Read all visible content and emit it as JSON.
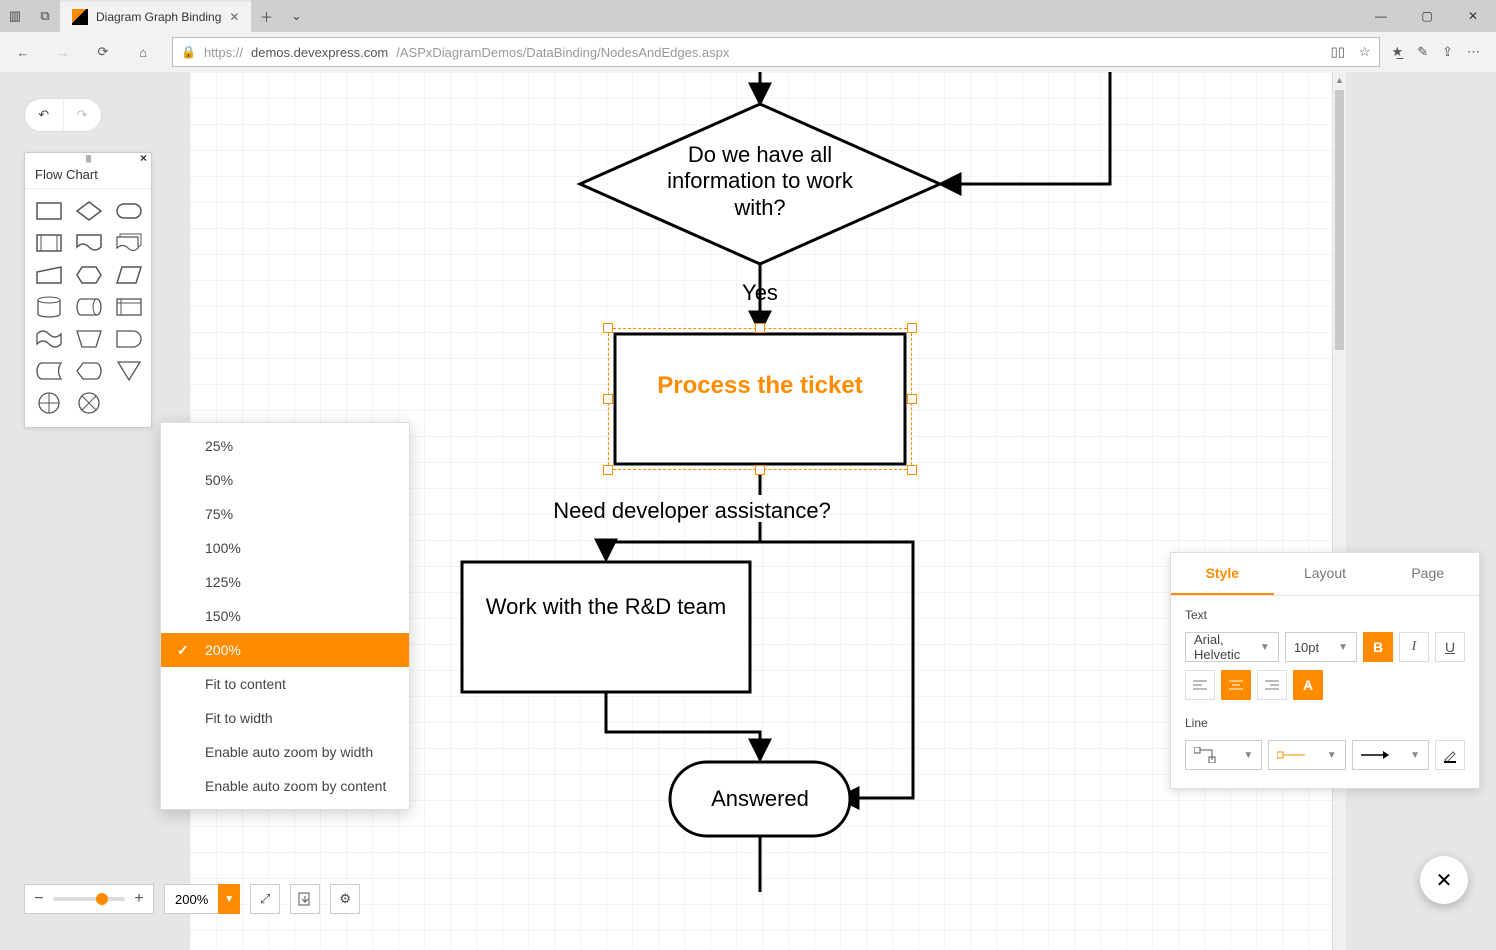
{
  "browser": {
    "tab_title": "Diagram Graph Binding",
    "url_host": "demos.devexpress.com",
    "url_path": "/ASPxDiagramDemos/DataBinding/NodesAndEdges.aspx"
  },
  "shapes_panel": {
    "title": "Flow Chart"
  },
  "diagram": {
    "decision_text": "Do we have all information to work with?",
    "decision_out_label": "Yes",
    "process_selected": "Process the ticket",
    "question_text": "Need developer assistance?",
    "work_rd": "Work with the R&D team",
    "answered": "Answered"
  },
  "zoom_menu": {
    "items": [
      "25%",
      "50%",
      "75%",
      "100%",
      "125%",
      "150%",
      "200%",
      "Fit to content",
      "Fit to width",
      "Enable auto zoom by width",
      "Enable auto zoom by content"
    ],
    "selected_index": 6
  },
  "zoom_value": "200%",
  "props": {
    "tabs": [
      "Style",
      "Layout",
      "Page"
    ],
    "active_tab": 0,
    "text_label": "Text",
    "line_label": "Line",
    "font_family": "Arial, Helvetic",
    "font_size": "10pt"
  }
}
